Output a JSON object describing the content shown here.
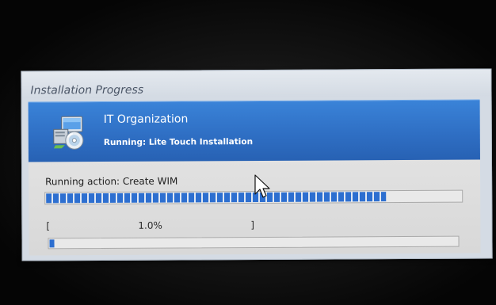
{
  "window": {
    "title": "Installation Progress"
  },
  "banner": {
    "organization": "IT Organization",
    "status": "Running: Lite Touch Installation",
    "icon": "computer-disc-icon"
  },
  "progress": {
    "action_text": "Running action: Create WIM",
    "main_progress_fraction": 0.82,
    "bracket_open": "[",
    "percent_text": "1.0%",
    "bracket_close": "]",
    "sub_progress_fraction": 0.01
  },
  "colors": {
    "banner_blue": "#2f6fc4",
    "progress_blue": "#2d6fd0",
    "screen_background": "#070707"
  }
}
